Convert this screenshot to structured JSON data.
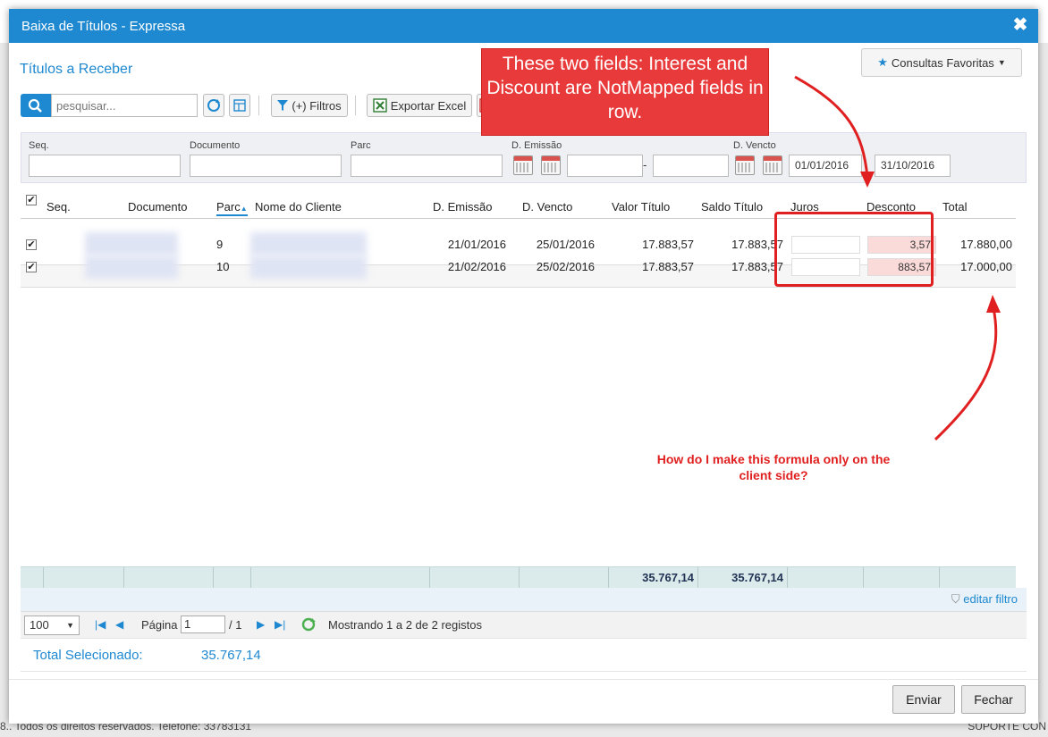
{
  "background": {
    "footer_left": "8.. Todos os direitos reservados. Telefone: 33783131",
    "footer_right": "SUPORTE CON"
  },
  "modal": {
    "title": "Baixa de Títulos - Expressa",
    "close_symbol": "✖",
    "section_title": "Títulos a Receber",
    "favorites_label": "Consultas Favoritas"
  },
  "toolbar": {
    "search_placeholder": "pesquisar...",
    "filter_label": "(+) Filtros",
    "export_excel_label": "Exportar Excel"
  },
  "filters": {
    "labels": {
      "seq": "Seq.",
      "documento": "Documento",
      "parc": "Parc",
      "d_emissao": "D. Emissão",
      "d_vencto": "D. Vencto"
    },
    "range_separator": "-",
    "vencto_from": "01/01/2016",
    "vencto_to": "31/10/2016"
  },
  "grid": {
    "headers": {
      "seq": "Seq.",
      "documento": "Documento",
      "parc": "Parc",
      "nome_cliente": "Nome do Cliente",
      "d_emissao": "D. Emissão",
      "d_vencto": "D. Vencto",
      "valor_titulo": "Valor Título",
      "saldo_titulo": "Saldo Título",
      "juros": "Juros",
      "desconto": "Desconto",
      "total": "Total"
    },
    "check_mark": "✔",
    "rows": [
      {
        "parc": "9",
        "d_emissao": "21/01/2016",
        "d_vencto": "25/01/2016",
        "valor_titulo": "17.883,57",
        "saldo_titulo": "17.883,57",
        "juros": "",
        "desconto": "3,57",
        "total": "17.880,00"
      },
      {
        "parc": "10",
        "d_emissao": "21/02/2016",
        "d_vencto": "25/02/2016",
        "valor_titulo": "17.883,57",
        "saldo_titulo": "17.883,57",
        "juros": "",
        "desconto": "883,57",
        "total": "17.000,00"
      }
    ],
    "sum_valor": "35.767,14",
    "sum_saldo": "35.767,14",
    "edit_filter_label": "editar filtro"
  },
  "pager": {
    "page_size": "100",
    "page_label": "Página",
    "page_value": "1",
    "page_total": "/ 1",
    "showing": "Mostrando 1 a 2 de 2 registos"
  },
  "totals": {
    "label": "Total Selecionado:",
    "value": "35.767,14"
  },
  "buttons": {
    "enviar": "Enviar",
    "fechar": "Fechar"
  },
  "annotations": {
    "callout": "These two fields: Interest and Discount are NotMapped fields in row.",
    "question": "How do I make this formula only on the client side?"
  },
  "colors": {
    "primary": "#1e88d0",
    "annotation_red": "#e02020",
    "discount_cell": "#fbdada"
  }
}
